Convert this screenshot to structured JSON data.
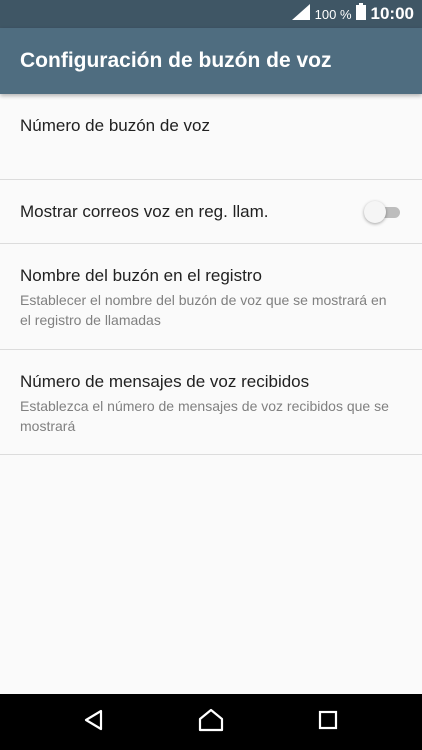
{
  "status_bar": {
    "battery_percent": "100 %",
    "time": "10:00",
    "signal_icon": "signal-icon",
    "battery_icon": "battery-icon"
  },
  "app_bar": {
    "title": "Configuración de buzón de voz"
  },
  "settings": [
    {
      "label": "Número de buzón de voz"
    },
    {
      "label": "Mostrar correos voz en reg. llam.",
      "toggle": {
        "enabled": false
      }
    },
    {
      "label": "Nombre del buzón en el registro",
      "summary": "Establecer el nombre del buzón de voz que se mostrará en el registro de llamadas"
    },
    {
      "label": "Número de mensajes de voz recibidos",
      "summary": "Establezca el número de mensajes de voz recibidos que se mostrará"
    }
  ],
  "nav_bar": {
    "back_icon": "back-icon",
    "home_icon": "home-icon",
    "recents_icon": "recents-icon"
  },
  "colors": {
    "status_bar": "#3f5665",
    "app_bar": "#4f6d80",
    "background": "#fafafa",
    "divider": "#dcdcdc",
    "primary_text": "#212121",
    "secondary_text": "#808080",
    "nav_bar": "#000000"
  }
}
